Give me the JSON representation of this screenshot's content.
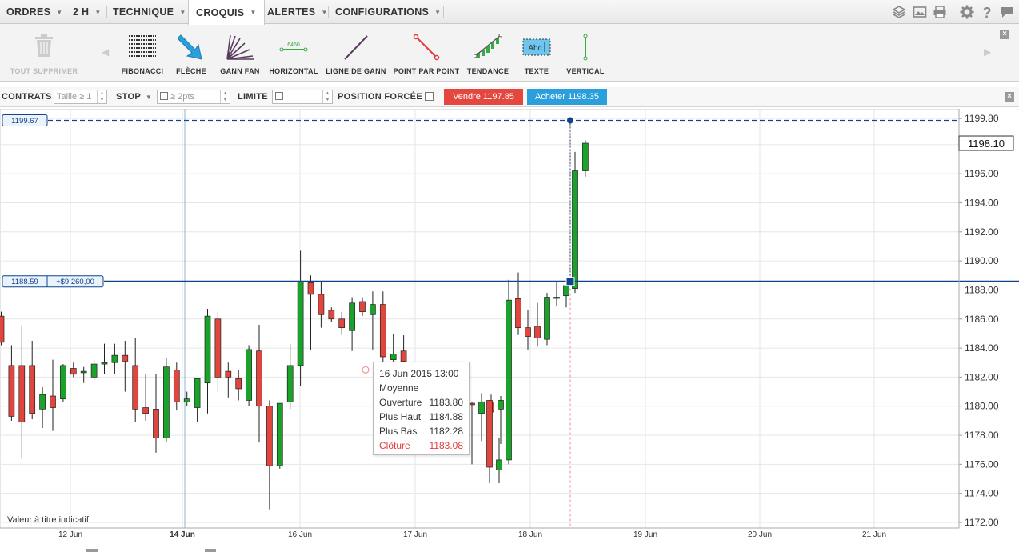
{
  "menu": {
    "items": [
      {
        "label": "ORDRES"
      },
      {
        "label": "2 H"
      },
      {
        "label": "TECHNIQUE"
      },
      {
        "label": "CROQUIS"
      },
      {
        "label": "ALERTES"
      },
      {
        "label": "CONFIGURATIONS"
      }
    ],
    "active": "CROQUIS",
    "right_icons": [
      "layers-icon",
      "image-icon",
      "print-icon",
      "gear-icon",
      "help-icon",
      "chat-icon"
    ]
  },
  "tools": {
    "delete_all": "TOUT SUPPRIMER",
    "items": [
      {
        "label": "FIBONACCI",
        "icon": "fibonacci-icon"
      },
      {
        "label": "FLÈCHE",
        "icon": "arrow-icon"
      },
      {
        "label": "GANN FAN",
        "icon": "gann-fan-icon"
      },
      {
        "label": "HORIZONTAL",
        "icon": "horizontal-line-icon",
        "sample_value": "6450"
      },
      {
        "label": "LIGNE DE GANN",
        "icon": "gann-line-icon"
      },
      {
        "label": "POINT PAR POINT",
        "icon": "point-to-point-icon"
      },
      {
        "label": "TENDANCE",
        "icon": "trend-icon"
      },
      {
        "label": "TEXTE",
        "icon": "text-icon",
        "sample_text": "Abc"
      },
      {
        "label": "VERTICAL",
        "icon": "vertical-line-icon"
      }
    ]
  },
  "orderbar": {
    "contracts_label": "CONTRATS",
    "contracts_placeholder": "Taille ≥ 1",
    "stop_label": "STOP",
    "stop_placeholder": "≥ 2pts",
    "limit_label": "LIMITE",
    "forced_label": "POSITION FORCÉE",
    "sell": "Vendre 1197.85",
    "buy": "Acheter 1198.35",
    "sell_color": "#e4473f",
    "buy_color": "#2a9fdc"
  },
  "chart": {
    "y_ticks": [
      "1199.80",
      "1198.00",
      "1196.00",
      "1194.00",
      "1192.00",
      "1190.00",
      "1188.00",
      "1186.00",
      "1184.00",
      "1182.00",
      "1180.00",
      "1178.00",
      "1176.00",
      "1174.00",
      "1172.00"
    ],
    "last_price": "1198.10",
    "x_ticks": [
      "12 Jun",
      "14 Jun",
      "16 Jun",
      "17 Jun",
      "18 Jun",
      "19 Jun",
      "20 Jun",
      "21 Jun"
    ],
    "dashed_level": "1199.67",
    "position_level": "1188.59",
    "position_pnl": "+$9 260,00",
    "disclaimer": "Valeur à titre indicatif",
    "up_color": "#1aa32a",
    "down_color": "#e0453e",
    "line_color": "#10458c"
  },
  "tooltip": {
    "date": "16 Jun 2015 13:00",
    "type": "Moyenne",
    "rows": [
      {
        "label": "Ouverture",
        "value": "1183.80"
      },
      {
        "label": "Plus Haut",
        "value": "1184.88"
      },
      {
        "label": "Plus Bas",
        "value": "1182.28"
      },
      {
        "label": "Clôture",
        "value": "1183.08"
      }
    ]
  },
  "chart_data": {
    "type": "candlestick",
    "ylim": [
      1171.5,
      1200.5
    ],
    "candles": [
      {
        "o": 1186.2,
        "h": 1186.5,
        "l": 1184.2,
        "c": 1184.4
      },
      {
        "o": 1182.8,
        "h": 1184.2,
        "l": 1179.0,
        "c": 1179.3
      },
      {
        "o": 1182.8,
        "h": 1185.5,
        "l": 1176.4,
        "c": 1178.9
      },
      {
        "o": 1182.8,
        "h": 1184.5,
        "l": 1179.1,
        "c": 1179.5
      },
      {
        "o": 1179.8,
        "h": 1181.3,
        "l": 1178.5,
        "c": 1180.8
      },
      {
        "o": 1180.7,
        "h": 1183.2,
        "l": 1178.3,
        "c": 1179.9
      },
      {
        "o": 1180.5,
        "h": 1182.9,
        "l": 1180.3,
        "c": 1182.8
      },
      {
        "o": 1182.6,
        "h": 1183.0,
        "l": 1182.0,
        "c": 1182.2
      },
      {
        "o": 1182.3,
        "h": 1182.7,
        "l": 1181.6,
        "c": 1182.4
      },
      {
        "o": 1182.0,
        "h": 1183.2,
        "l": 1181.8,
        "c": 1182.9
      },
      {
        "o": 1182.9,
        "h": 1184.3,
        "l": 1182.2,
        "c": 1183.0
      },
      {
        "o": 1183.0,
        "h": 1184.3,
        "l": 1182.2,
        "c": 1183.5
      },
      {
        "o": 1183.5,
        "h": 1184.5,
        "l": 1181.0,
        "c": 1183.1
      },
      {
        "o": 1182.8,
        "h": 1184.7,
        "l": 1178.9,
        "c": 1179.8
      },
      {
        "o": 1179.9,
        "h": 1182.2,
        "l": 1179.0,
        "c": 1179.5
      },
      {
        "o": 1179.8,
        "h": 1182.2,
        "l": 1176.8,
        "c": 1177.8
      },
      {
        "o": 1177.8,
        "h": 1183.3,
        "l": 1177.5,
        "c": 1182.7
      },
      {
        "o": 1182.5,
        "h": 1183.0,
        "l": 1179.7,
        "c": 1180.3
      },
      {
        "o": 1180.3,
        "h": 1181.0,
        "l": 1180.0,
        "c": 1180.5
      },
      {
        "o": 1179.9,
        "h": 1181.9,
        "l": 1178.9,
        "c": 1181.9
      },
      {
        "o": 1181.6,
        "h": 1186.7,
        "l": 1179.5,
        "c": 1186.2
      },
      {
        "o": 1186.0,
        "h": 1186.5,
        "l": 1181.0,
        "c": 1182.0
      },
      {
        "o": 1182.4,
        "h": 1183.0,
        "l": 1180.6,
        "c": 1182.0
      },
      {
        "o": 1181.9,
        "h": 1182.5,
        "l": 1180.4,
        "c": 1181.2
      },
      {
        "o": 1180.4,
        "h": 1184.2,
        "l": 1180.0,
        "c": 1183.9
      },
      {
        "o": 1183.8,
        "h": 1185.6,
        "l": 1177.5,
        "c": 1180.0
      },
      {
        "o": 1180.0,
        "h": 1180.4,
        "l": 1172.9,
        "c": 1175.9
      },
      {
        "o": 1175.9,
        "h": 1180.2,
        "l": 1175.7,
        "c": 1180.2
      },
      {
        "o": 1180.3,
        "h": 1184.3,
        "l": 1179.8,
        "c": 1182.8
      },
      {
        "o": 1182.8,
        "h": 1190.7,
        "l": 1181.4,
        "c": 1188.6
      },
      {
        "o": 1188.5,
        "h": 1189.0,
        "l": 1183.9,
        "c": 1187.7
      },
      {
        "o": 1187.7,
        "h": 1188.6,
        "l": 1185.4,
        "c": 1186.3
      },
      {
        "o": 1186.6,
        "h": 1186.8,
        "l": 1185.8,
        "c": 1186.0
      },
      {
        "o": 1186.0,
        "h": 1186.5,
        "l": 1184.9,
        "c": 1185.4
      },
      {
        "o": 1185.2,
        "h": 1187.5,
        "l": 1183.8,
        "c": 1187.1
      },
      {
        "o": 1187.2,
        "h": 1187.5,
        "l": 1186.2,
        "c": 1186.5
      },
      {
        "o": 1186.3,
        "h": 1187.9,
        "l": 1183.9,
        "c": 1187.0
      },
      {
        "o": 1187.0,
        "h": 1187.9,
        "l": 1182.0,
        "c": 1183.4
      },
      {
        "o": 1183.2,
        "h": 1185.0,
        "l": 1182.0,
        "c": 1183.6
      },
      {
        "o": 1183.8,
        "h": 1184.88,
        "l": 1182.28,
        "c": 1183.08
      },
      {
        "o": 1180.2,
        "h": 1180.3,
        "l": 1176.0,
        "c": 1180.1
      },
      {
        "o": 1179.5,
        "h": 1180.9,
        "l": 1177.6,
        "c": 1180.3
      },
      {
        "o": 1180.3,
        "h": 1180.8,
        "l": 1179.6,
        "c": 1179.6
      },
      {
        "o": 1179.8,
        "h": 1180.7,
        "l": 1177.4,
        "c": 1180.4
      },
      {
        "o": 1180.4,
        "h": 1180.4,
        "l": 1174.7,
        "c": 1175.8
      },
      {
        "o": 1175.6,
        "h": 1177.8,
        "l": 1174.7,
        "c": 1176.3
      },
      {
        "o": 1176.3,
        "h": 1188.7,
        "l": 1176.0,
        "c": 1187.3
      },
      {
        "o": 1187.4,
        "h": 1189.2,
        "l": 1184.9,
        "c": 1185.4
      },
      {
        "o": 1185.4,
        "h": 1186.6,
        "l": 1183.9,
        "c": 1184.8
      },
      {
        "o": 1185.5,
        "h": 1187.1,
        "l": 1184.1,
        "c": 1184.7
      },
      {
        "o": 1184.6,
        "h": 1187.8,
        "l": 1184.2,
        "c": 1187.5
      },
      {
        "o": 1187.5,
        "h": 1188.6,
        "l": 1186.9,
        "c": 1187.5
      },
      {
        "o": 1187.6,
        "h": 1188.4,
        "l": 1186.8,
        "c": 1188.3
      },
      {
        "o": 1188.1,
        "h": 1197.5,
        "l": 1187.8,
        "c": 1196.2
      },
      {
        "o": 1196.2,
        "h": 1198.3,
        "l": 1195.8,
        "c": 1198.1
      }
    ]
  }
}
